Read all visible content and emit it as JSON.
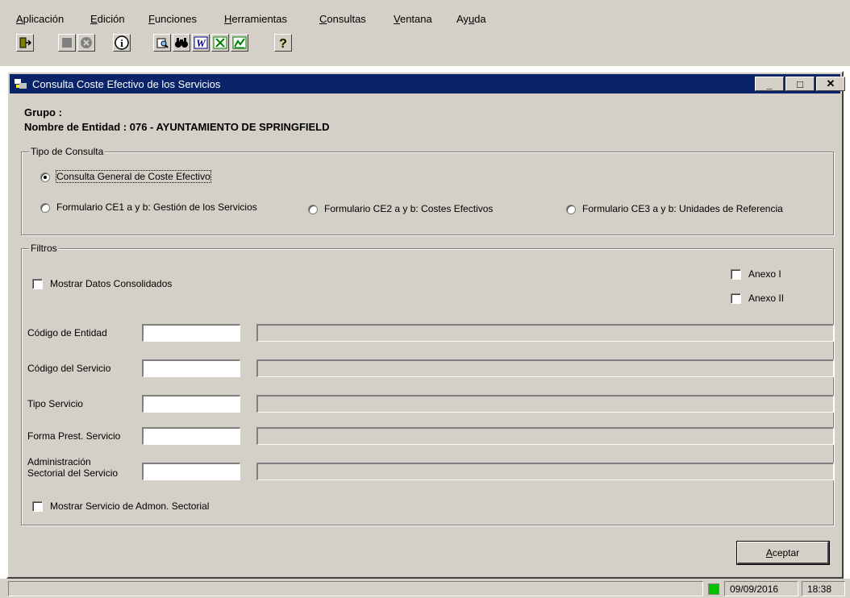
{
  "menu": [
    {
      "u": "A",
      "rest": "plicación"
    },
    {
      "u": "E",
      "rest": "dición"
    },
    {
      "u": "F",
      "rest": "unciones"
    },
    {
      "u": "H",
      "rest": "erramientas"
    },
    {
      "u": "C",
      "rest": "onsultas"
    },
    {
      "u": "V",
      "rest": "entana"
    },
    {
      "pre": "Ay",
      "u": "u",
      "rest": "da"
    }
  ],
  "toolbar": {
    "icons": [
      "exit-icon",
      "stop-icon",
      "cancel-icon",
      "info-icon",
      "print-preview-icon",
      "find-icon",
      "word-icon",
      "excel-icon",
      "chart-icon",
      "help-icon"
    ],
    "info_glyph": "i",
    "help_glyph": "?",
    "find_glyph": "🔭"
  },
  "window": {
    "title": "Consulta Coste Efectivo de los Servicios",
    "min": "_",
    "max": "□",
    "close": "✕"
  },
  "header": {
    "grupo": "Grupo :",
    "entidad": "Nombre de Entidad : 076 - AYUNTAMIENTO DE SPRINGFIELD"
  },
  "tipo_consulta": {
    "legend": "Tipo de Consulta",
    "options": [
      "Consulta General de Coste Efectivo",
      "Formulario CE1 a y b: Gestión de los Servicios",
      "Formulario CE2 a y b: Costes Efectivos",
      "Formulario CE3 a y b: Unidades de Referencia"
    ]
  },
  "filtros": {
    "legend": "Filtros",
    "mostrar_consolidados": "Mostrar Datos Consolidados",
    "anexo1": "Anexo I",
    "anexo2": "Anexo II",
    "fields": [
      "Código de Entidad",
      "Código del Servicio",
      "Tipo Servicio",
      "Forma Prest. Servicio"
    ],
    "admin_line1": "Administración",
    "admin_line2": "Sectorial del Servicio",
    "mostrar_admon": "Mostrar Servicio de Admon. Sectorial"
  },
  "aceptar": {
    "u": "A",
    "rest": "ceptar"
  },
  "status": {
    "date": "09/09/2016",
    "time": "18:38",
    "indicator_color": "#00c000"
  },
  "colors": {
    "titlebar": "#0a246a",
    "face": "#d4d0c8"
  }
}
